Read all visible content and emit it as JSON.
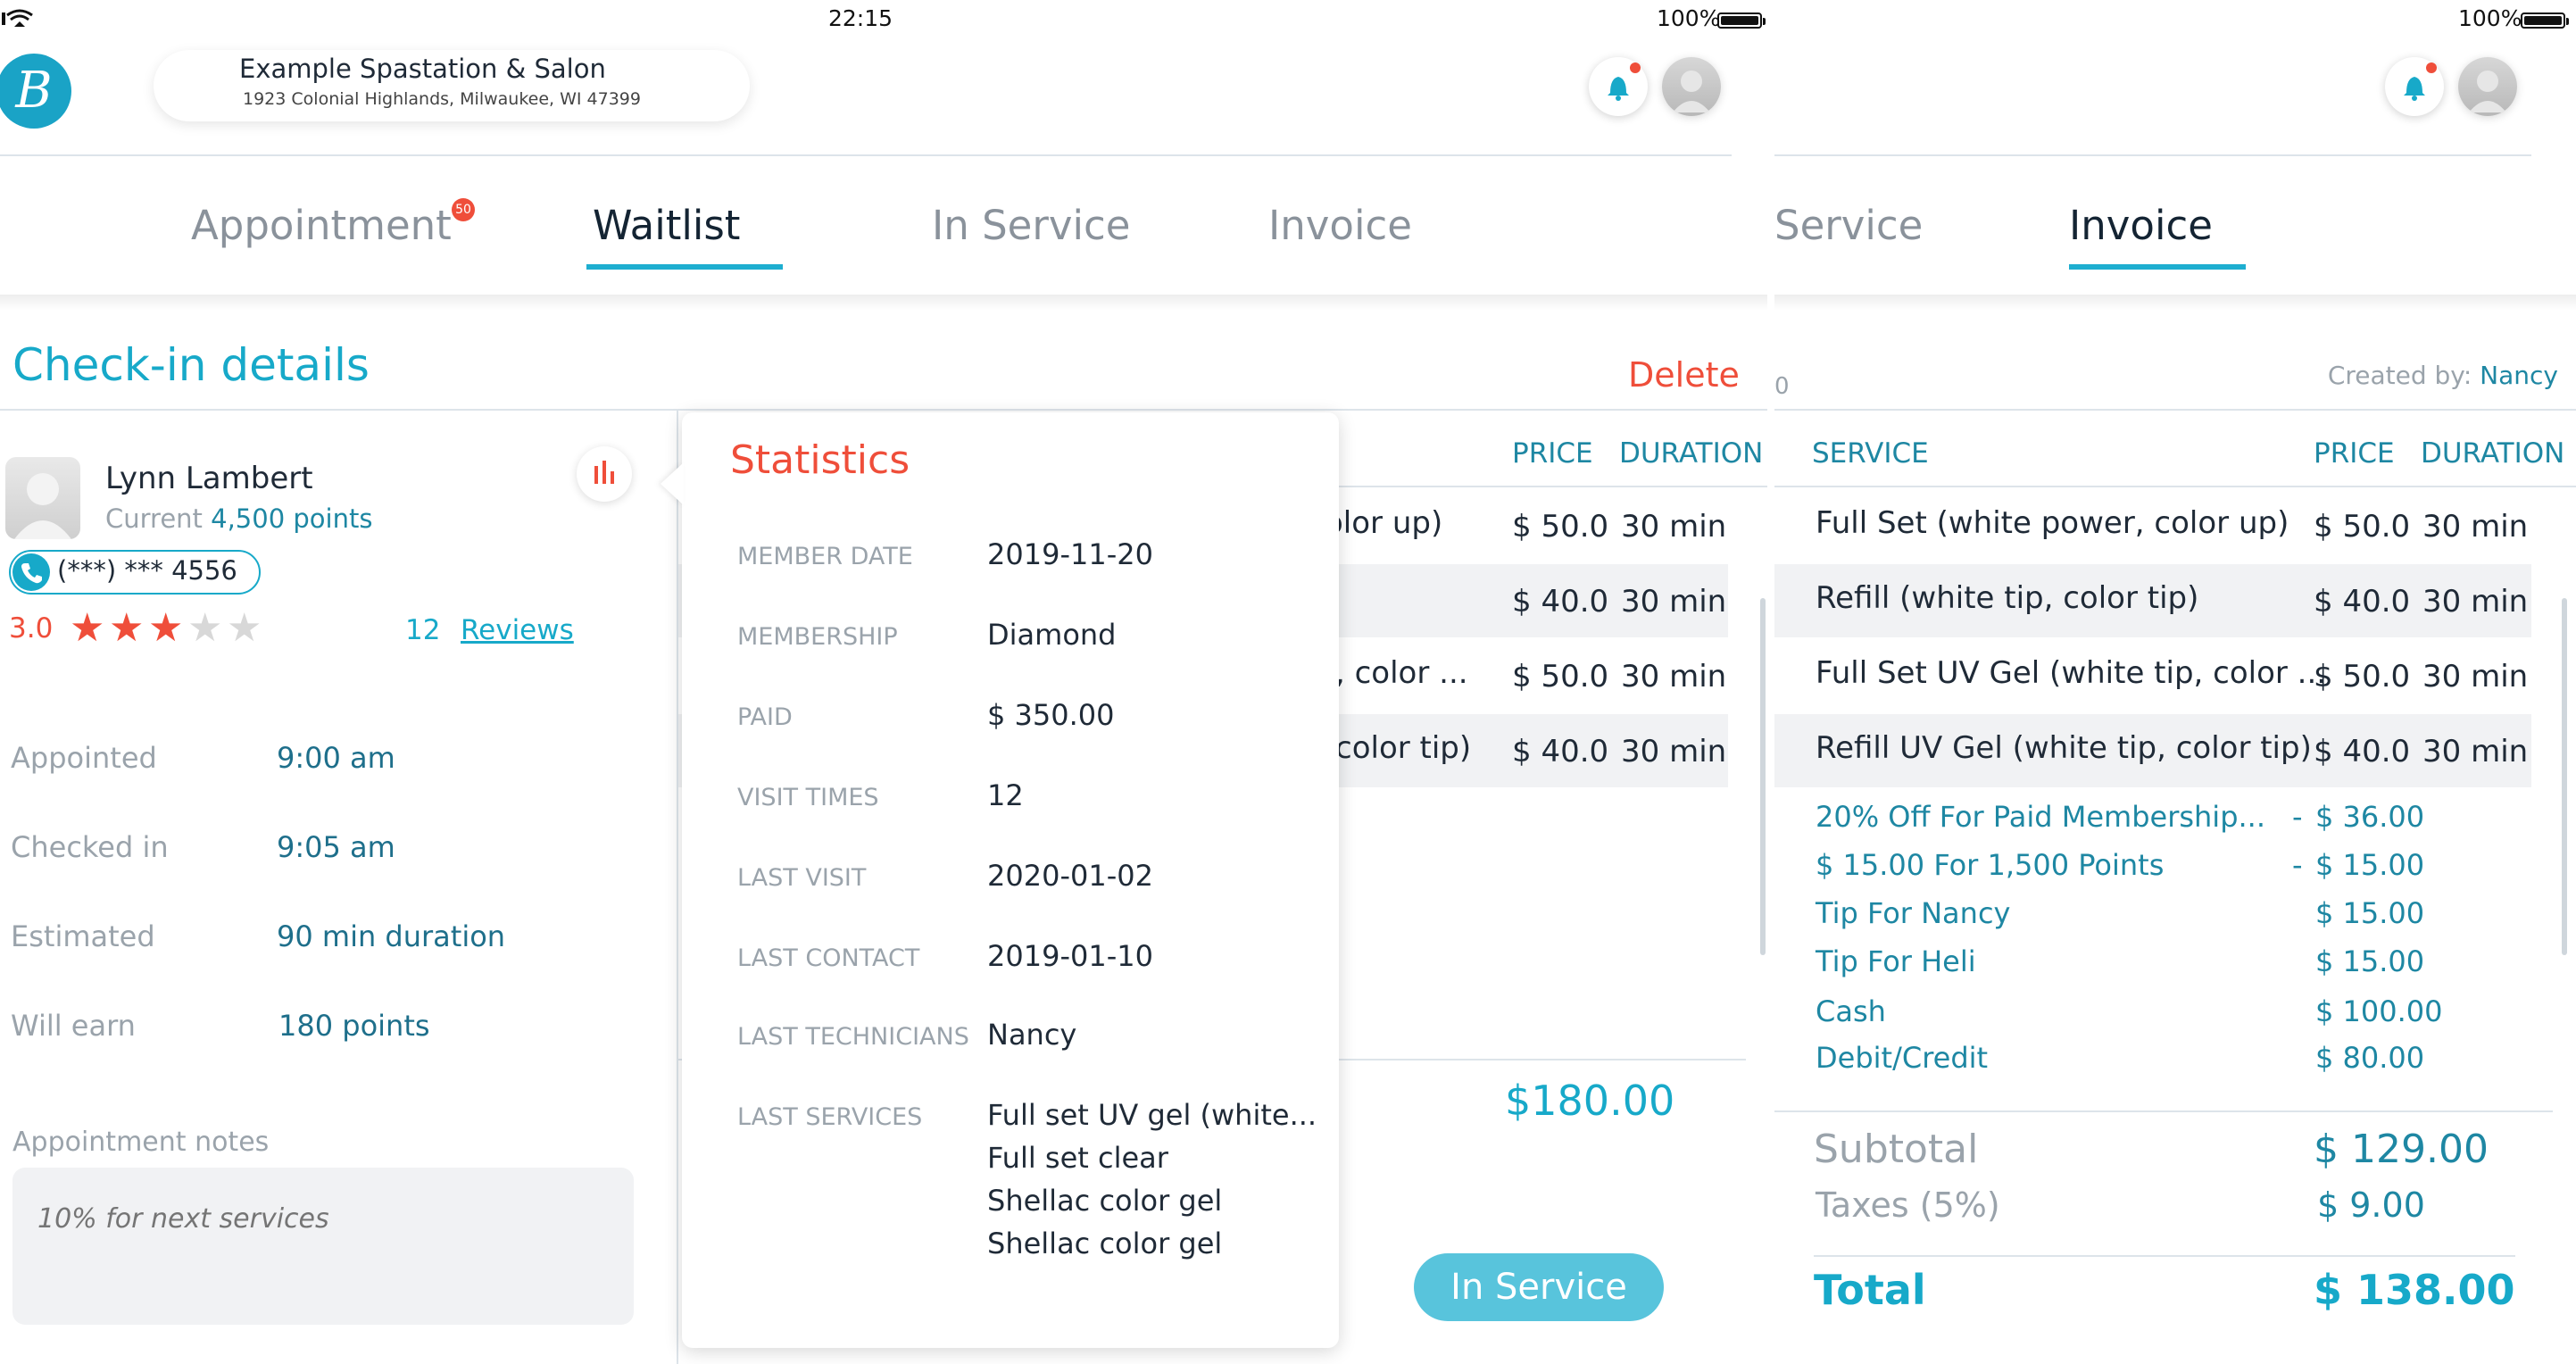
{
  "status_bar": {
    "time": "22:15",
    "battery": "100%",
    "battery_right": "100%"
  },
  "salon": {
    "name": "Example Spastation & Salon",
    "address": "1923 Colonial Highlands, Milwaukee, WI 47399"
  },
  "logo_letter": "B",
  "tabs": [
    {
      "label": "Appointment",
      "badge": "50"
    },
    {
      "label": "Waitlist"
    },
    {
      "label": "In Service"
    },
    {
      "label": "Invoice"
    }
  ],
  "right_tabs": [
    {
      "label": "Service"
    },
    {
      "label": "Invoice"
    }
  ],
  "checkin": {
    "title": "Check-in details",
    "delete_label": "Delete",
    "customer": {
      "name": "Lynn Lambert",
      "points_prefix": "Current",
      "points_value": "4,500 points",
      "phone": "(***) *** 4556",
      "rating": "3.0",
      "stars": 3,
      "reviews_count": "12",
      "reviews_label": "Reviews"
    },
    "details": [
      {
        "label": "Appointed",
        "value": "9:00 am"
      },
      {
        "label": "Checked in",
        "value": "9:05 am"
      },
      {
        "label": "Estimated",
        "value": "90 min duration"
      },
      {
        "label": "Will earn",
        "value": "180 points"
      }
    ],
    "notes_label": "Appointment notes",
    "notes_placeholder": "10% for next services"
  },
  "statistics": {
    "title": "Statistics",
    "rows": [
      {
        "label": "MEMBER DATE",
        "value": "2019-11-20"
      },
      {
        "label": "MEMBERSHIP",
        "value": "Diamond"
      },
      {
        "label": "PAID",
        "value": "$ 350.00"
      },
      {
        "label": "VISIT TIMES",
        "value": "12"
      },
      {
        "label": "LAST VISIT",
        "value": "2020-01-02"
      },
      {
        "label": "LAST CONTACT",
        "value": "2019-01-10"
      },
      {
        "label": "LAST TECHNICIANS",
        "value": "Nancy"
      },
      {
        "label": "LAST SERVICES",
        "values": [
          "Full set UV gel (white...",
          "Full set clear",
          "Shellac color gel",
          "Shellac color gel"
        ]
      }
    ]
  },
  "left_services": {
    "headers": {
      "price": "PRICE",
      "duration": "DURATION"
    },
    "rows": [
      {
        "name": "olor up)",
        "price": "$ 50.0",
        "duration": "30 min"
      },
      {
        "name": ")",
        "price": "$ 40.0",
        "duration": "30 min"
      },
      {
        "name": ", color ...",
        "price": "$ 50.0",
        "duration": "30 min"
      },
      {
        "name": "color tip)",
        "price": "$ 40.0",
        "duration": "30 min"
      }
    ],
    "total": "$180.00",
    "in_service_button": "In Service"
  },
  "invoice": {
    "number_fragment": "0",
    "created_by_label": "Created by:",
    "created_by": "Nancy",
    "headers": {
      "service": "SERVICE",
      "price": "PRICE",
      "duration": "DURATION"
    },
    "rows": [
      {
        "name": "Full Set (white power, color up)",
        "price": "$ 50.0",
        "duration": "30 min"
      },
      {
        "name": "Refill (white tip, color tip)",
        "price": "$ 40.0",
        "duration": "30 min"
      },
      {
        "name": "Full Set UV Gel (white tip, color ...",
        "price": "$ 50.0",
        "duration": "30 min"
      },
      {
        "name": "Refill UV Gel (white tip, color tip)",
        "price": "$ 40.0",
        "duration": "30 min"
      }
    ],
    "adjustments": [
      {
        "label": "20% Off For Paid Membership...",
        "sign": "-",
        "amount": "$ 36.00"
      },
      {
        "label": "$ 15.00 For 1,500 Points",
        "sign": "-",
        "amount": "$ 15.00"
      },
      {
        "label": "Tip For Nancy",
        "sign": "",
        "amount": "$ 15.00"
      },
      {
        "label": "Tip For Heli",
        "sign": "",
        "amount": "$ 15.00"
      },
      {
        "label": "Cash",
        "sign": "",
        "amount": "$ 100.00"
      },
      {
        "label": "Debit/Credit",
        "sign": "",
        "amount": "$ 80.00"
      }
    ],
    "subtotal_label": "Subtotal",
    "subtotal": "$ 129.00",
    "taxes_label": "Taxes (5%)",
    "taxes": "$ 9.00",
    "total_label": "Total",
    "total": "$ 138.00"
  },
  "colors": {
    "accent": "#17a9c9",
    "danger": "#ef4e3a",
    "star": "#ef4e3a"
  }
}
